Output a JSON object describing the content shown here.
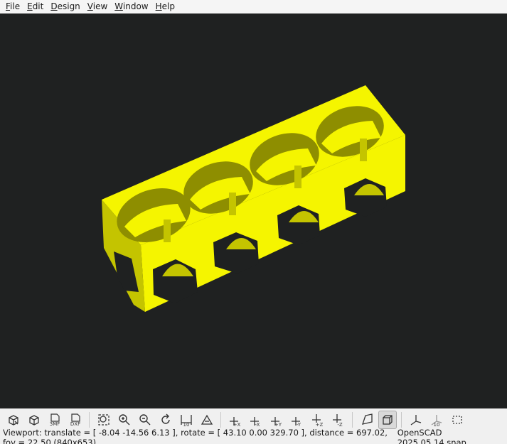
{
  "menu": [
    {
      "mnemonic": "F",
      "rest": "ile"
    },
    {
      "mnemonic": "E",
      "rest": "dit"
    },
    {
      "mnemonic": "D",
      "rest": "esign"
    },
    {
      "mnemonic": "V",
      "rest": "iew"
    },
    {
      "mnemonic": "W",
      "rest": "indow"
    },
    {
      "mnemonic": "H",
      "rest": "elp"
    }
  ],
  "colors": {
    "viewport_bg": "#1f2121",
    "model": "#f5f500",
    "model_shade": "#c4c400",
    "model_dark": "#8e8e00"
  },
  "toolbar": {
    "buttons": [
      {
        "icon": "preview-icon",
        "name": "preview-button"
      },
      {
        "icon": "render-icon",
        "name": "render-button"
      },
      {
        "icon": "export-3mf-icon",
        "name": "export-3mf-button",
        "text": "3MF"
      },
      {
        "icon": "export-dxf-icon",
        "name": "export-dxf-button",
        "text": "DXF"
      },
      {
        "icon": "view-all-icon",
        "name": "view-all-button"
      },
      {
        "icon": "zoom-in-icon",
        "name": "zoom-in-button"
      },
      {
        "icon": "zoom-out-icon",
        "name": "zoom-out-button"
      },
      {
        "icon": "reset-view-icon",
        "name": "reset-view-button"
      },
      {
        "icon": "measure-distance-icon",
        "name": "measure-distance-button",
        "text": "10"
      },
      {
        "icon": "measure-angle-icon",
        "name": "measure-angle-button"
      },
      {
        "icon": "view-right-icon",
        "name": "view-right-button",
        "text": "+X"
      },
      {
        "icon": "view-left-icon",
        "name": "view-left-button",
        "text": "-X"
      },
      {
        "icon": "view-back-icon",
        "name": "view-back-button",
        "text": "+Y"
      },
      {
        "icon": "view-front-icon",
        "name": "view-front-button",
        "text": "-Y"
      },
      {
        "icon": "view-top-icon",
        "name": "view-top-button",
        "text": "+Z"
      },
      {
        "icon": "view-bottom-icon",
        "name": "view-bottom-button",
        "text": "-Z"
      },
      {
        "icon": "perspective-icon",
        "name": "perspective-button"
      },
      {
        "icon": "orthogonal-icon",
        "name": "orthogonal-button",
        "active": true
      },
      {
        "icon": "show-axes-icon",
        "name": "show-axes-button"
      },
      {
        "icon": "show-scale-icon",
        "name": "show-scale-button",
        "text": "10"
      },
      {
        "icon": "show-edges-icon",
        "name": "show-edges-button"
      }
    ]
  },
  "status": {
    "viewport": "Viewport: translate = [ -8.04 -14.56 6.13 ], rotate = [ 43.10 0.00 329.70 ], distance = 697.02, fov = 22.50 (840x653)",
    "version": "OpenSCAD 2025.05.14.snap"
  }
}
